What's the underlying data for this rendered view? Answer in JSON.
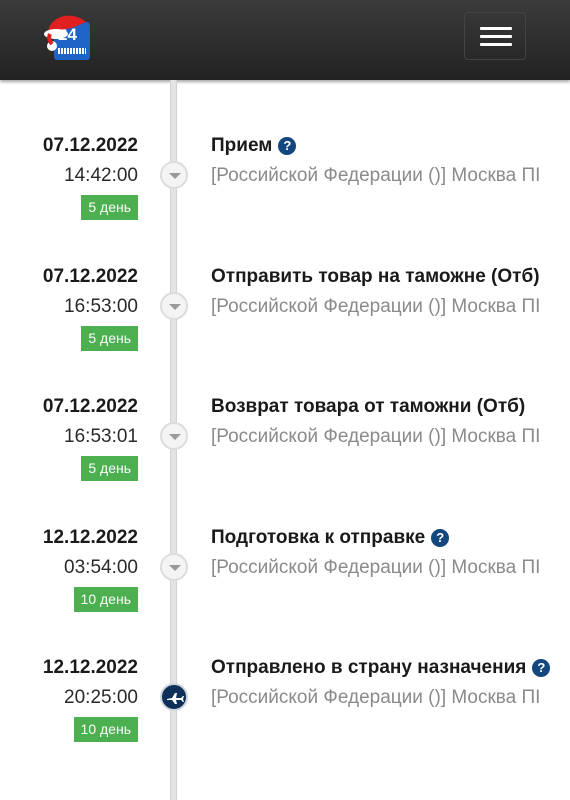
{
  "header": {
    "logo_text": "24",
    "menu_icon": "hamburger-icon"
  },
  "events": [
    {
      "date": "07.12.2022",
      "time": "14:42:00",
      "days": "5 день",
      "status": "Прием",
      "help": true,
      "location": "[Российской Федерации ()] Москва ПІ",
      "marker": "chevron-down-icon"
    },
    {
      "date": "07.12.2022",
      "time": "16:53:00",
      "days": "5 день",
      "status": "Отправить товар на таможне (Отб)",
      "help": false,
      "location": "[Российской Федерации ()] Москва ПІ",
      "marker": "chevron-down-icon"
    },
    {
      "date": "07.12.2022",
      "time": "16:53:01",
      "days": "5 день",
      "status": "Возврат товара от таможни (Отб)",
      "help": false,
      "location": "[Российской Федерации ()] Москва ПІ",
      "marker": "chevron-down-icon"
    },
    {
      "date": "12.12.2022",
      "time": "03:54:00",
      "days": "10 день",
      "status": "Подготовка к отправке",
      "help": true,
      "location": "[Российской Федерации ()] Москва ПІ",
      "marker": "chevron-down-icon"
    },
    {
      "date": "12.12.2022",
      "time": "20:25:00",
      "days": "10 день",
      "status": "Отправлено в страну назначения",
      "help": true,
      "location": "[Российской Федерации ()] Москва ПІ",
      "marker": "airplane-icon"
    }
  ],
  "colors": {
    "header_bg": "#2b2b2b",
    "badge_green": "#4cb050",
    "help_blue": "#14477e",
    "plane_navy": "#0e2f57"
  },
  "help_symbol": "?"
}
